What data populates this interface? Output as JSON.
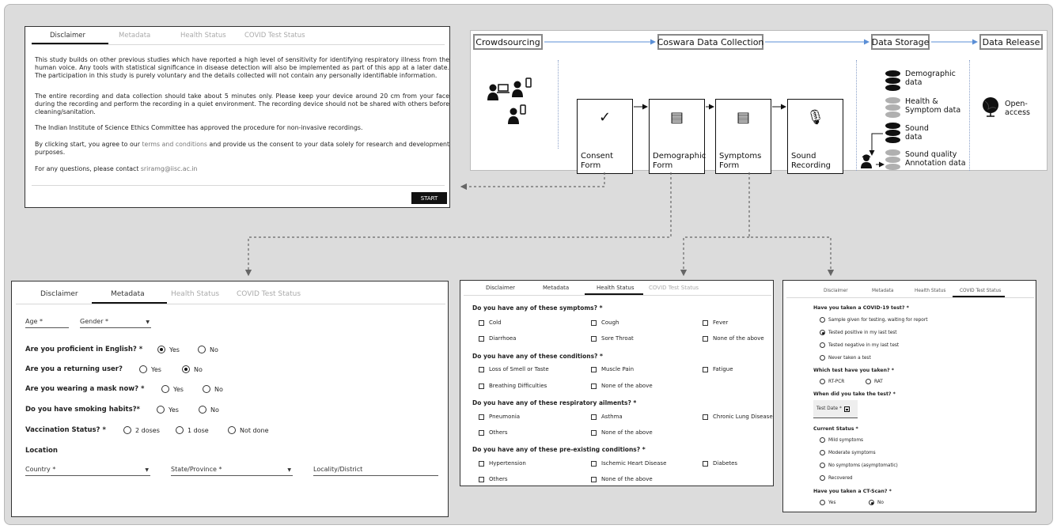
{
  "colors": {
    "arrow_blue": "#5b8fd6",
    "connector_gray": "#666666",
    "db_dark": "#111111",
    "db_gray": "#b0b0b0"
  },
  "tabs": {
    "disclaimer": "Disclaimer",
    "metadata": "Metadata",
    "health": "Health Status",
    "covid": "COVID Test Status"
  },
  "disclaimer": {
    "p1": "This study builds on other previous studies which have reported a high level of sensitivity for identifying respiratory illness from the human voice. Any tools with statistical significance in disease detection will also be implemented as part of this app at a later date. The participation in this study is purely voluntary and the details collected will not contain any personally identifiable information.",
    "p2": "The entire recording and data collection should take about 5 minutes only. Please keep your device around 20 cm from your face during the recording and perform the recording in a quiet environment. The recording device should not be shared with others before cleaning/sanitation.",
    "p3": "The Indian Institute of Science Ethics Committee has approved the procedure for non-invasive recordings.",
    "p4_pre": "By clicking start, you agree to our ",
    "p4_link": "terms and conditions",
    "p4_post": " and provide us the consent to your data solely for research and development purposes.",
    "p5_pre": "For any questions, please contact ",
    "p5_email": "sriramg@iisc.ac.in",
    "start": "START"
  },
  "flow": {
    "crowdsourcing": "Crowdsourcing",
    "collection": "Coswara Data Collection",
    "storage": "Data Storage",
    "release": "Data Release",
    "forms": [
      {
        "line1": "Consent",
        "line2": "Form",
        "icon": "check-icon",
        "glyph": "✓"
      },
      {
        "line1": "Demographic",
        "line2": "Form",
        "icon": "list-doc-icon",
        "glyph": "▤"
      },
      {
        "line1": "Symptoms",
        "line2": "Form",
        "icon": "list-doc-icon",
        "glyph": "▤"
      },
      {
        "line1": "Sound",
        "line2": "Recording",
        "icon": "microphone-icon",
        "glyph": "🎙"
      }
    ],
    "storage_items": [
      {
        "line1": "Demographic",
        "line2": "data"
      },
      {
        "line1": "Health &",
        "line2": "Symptom data"
      },
      {
        "line1": "Sound",
        "line2": "data"
      },
      {
        "line1": "Sound quality",
        "line2": "Annotation data"
      }
    ],
    "release_label": "Open-access"
  },
  "metadata_form": {
    "age": "Age *",
    "gender": "Gender *",
    "q_english": "Are you proficient in English? *",
    "q_returning": "Are you a returning user?",
    "q_mask": "Are you wearing a mask now? *",
    "q_smoking": "Do you have smoking habits?*",
    "q_vaccination": "Vaccination Status? *",
    "yes": "Yes",
    "no": "No",
    "dose2": "2 doses",
    "dose1": "1 dose",
    "notdone": "Not done",
    "location": "Location",
    "country": "Country *",
    "state": "State/Province *",
    "locality": "Locality/District"
  },
  "health_form": {
    "q1": "Do you have any of these symptoms? *",
    "q1_opts": [
      "Cold",
      "Cough",
      "Fever",
      "Diarrhoea",
      "Sore Throat",
      "None of the above"
    ],
    "q2": "Do you have any of these conditions? *",
    "q2_opts": [
      "Loss of Smell or Taste",
      "Muscle Pain",
      "Fatigue",
      "Breathing Difficulties",
      "None of the above"
    ],
    "q3": "Do you have any of these respiratory ailments? *",
    "q3_opts": [
      "Pneumonia",
      "Asthma",
      "Chronic Lung Disease",
      "Others",
      "None of the above"
    ],
    "q4": "Do you have any of these pre-existing conditions? *",
    "q4_opts": [
      "Hypertension",
      "Ischemic Heart Disease",
      "Diabetes",
      "Others",
      "None of the above"
    ]
  },
  "covid_form": {
    "q1": "Have you taken a COVID-19 test? *",
    "q1_opts": [
      "Sample given for testing, waiting for report",
      "Tested positive in my last test",
      "Tested negative in my last test",
      "Never taken a test"
    ],
    "q1_selected": "Tested positive in my last test",
    "q2": "Which test have you taken? *",
    "q2_opts": [
      "RT-PCR",
      "RAT"
    ],
    "q3": "When did you take the test? *",
    "test_date": "Test Date *",
    "q4": "Current Status *",
    "q4_opts": [
      "Mild symptoms",
      "Moderate symptoms",
      "No symptoms (asymptomatic)",
      "Recovered"
    ],
    "q5": "Have you taken a CT-Scan? *",
    "q5_yes": "Yes",
    "q5_no": "No",
    "q5_selected": "No"
  }
}
